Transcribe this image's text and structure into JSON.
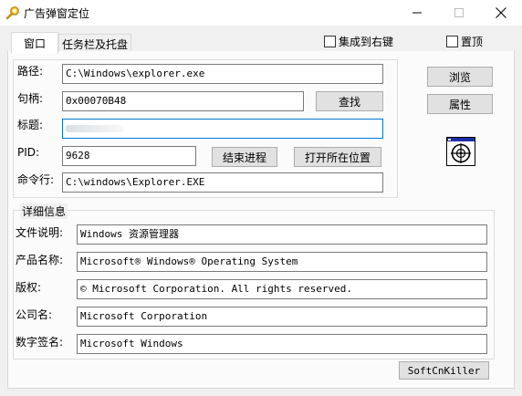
{
  "window": {
    "title": "广告弹窗定位",
    "controls": {
      "minimize": "minimize-icon",
      "maximize": "maximize-icon",
      "close": "close-icon"
    }
  },
  "tabs": [
    {
      "label": "窗口",
      "active": true
    },
    {
      "label": "任务栏及托盘",
      "active": false
    }
  ],
  "options": {
    "integrate_right_click": {
      "label": "集成到右键",
      "checked": false
    },
    "topmost": {
      "label": "置顶",
      "checked": false
    }
  },
  "window_info": {
    "path_label": "路径:",
    "path_value": "C:\\Windows\\explorer.exe",
    "handle_label": "句柄:",
    "handle_value": "0x00070B48",
    "title_label": "标题:",
    "title_value": "",
    "pid_label": "PID:",
    "pid_value": "9628",
    "cmdline_label": "命令行:",
    "cmdline_value": "C:\\windows\\Explorer.EXE"
  },
  "buttons": {
    "find": "查找",
    "end_process": "结束进程",
    "open_location": "打开所在位置",
    "browse": "浏览",
    "properties": "属性",
    "softcnkiller": "SoftCnKiller"
  },
  "details": {
    "legend": "详细信息",
    "rows": [
      {
        "label": "文件说明:",
        "value": "Windows 资源管理器"
      },
      {
        "label": "产品名称:",
        "value": "Microsoft® Windows® Operating System"
      },
      {
        "label": "版权:",
        "value": "© Microsoft Corporation. All rights reserved."
      },
      {
        "label": "公司名:",
        "value": "Microsoft Corporation"
      },
      {
        "label": "数字签名:",
        "value": "Microsoft Windows"
      }
    ]
  },
  "icons": {
    "app": "magnifier-icon",
    "finder": "finder-target-icon"
  }
}
